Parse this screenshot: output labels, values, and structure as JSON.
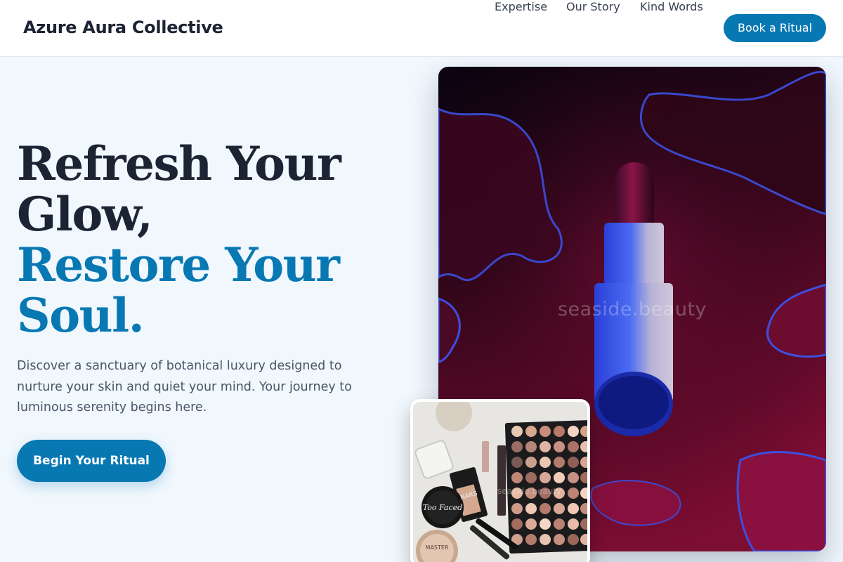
{
  "header": {
    "brand": "Azure Aura Collective",
    "nav": [
      "Expertise",
      "Our Story",
      "Kind Words"
    ],
    "cta_label": "Book a Ritual"
  },
  "hero": {
    "headline_line1": "Refresh Your",
    "headline_line2": "Glow,",
    "headline_line3": "Restore Your",
    "headline_line4": "Soul.",
    "description": "Discover a sanctuary of botanical luxury designed to nurture your skin and quiet your mind. Your journey to luminous serenity begins here.",
    "cta_label": "Begin Your Ritual"
  },
  "images": {
    "main_watermark": "seaside.beauty",
    "sub_watermark": "seaside.beauty",
    "compact_label_1": "Too Faced",
    "compact_label_2": "MASTER",
    "tube_label": "NARS"
  },
  "colors": {
    "accent": "#0878b3",
    "heading": "#1c2434",
    "body_text": "#4a5566",
    "page_background": "#f0f7fd"
  }
}
